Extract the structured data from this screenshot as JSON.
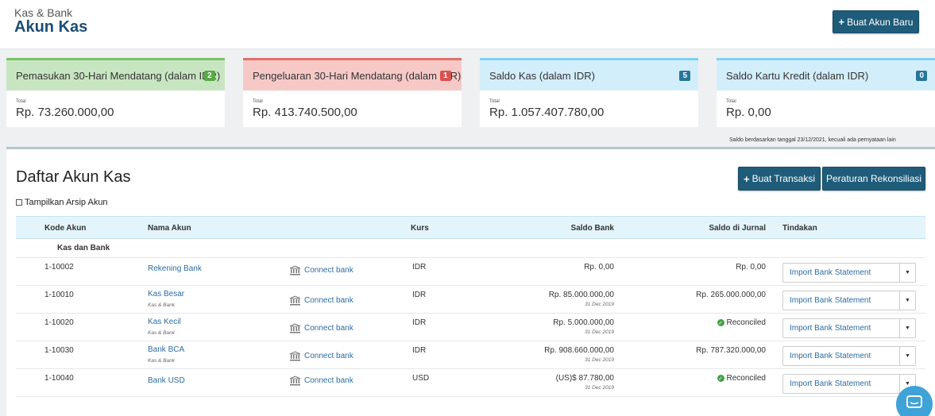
{
  "header": {
    "breadcrumb": "Kas & Bank",
    "title": "Akun Kas",
    "new_account_button": "Buat Akun Baru"
  },
  "cards": [
    {
      "title": "Pemasukan 30-Hari Mendatang (dalam IDR)",
      "badge": "2",
      "total_label": "Total",
      "value": "Rp. 73.260.000,00"
    },
    {
      "title": "Pengeluaran 30-Hari Mendatang (dalam IDR)",
      "badge": "1",
      "total_label": "Total",
      "value": "Rp. 413.740.500,00"
    },
    {
      "title": "Saldo Kas (dalam IDR)",
      "badge": "5",
      "total_label": "Total",
      "value": "Rp. 1.057.407.780,00"
    },
    {
      "title": "Saldo Kartu Kredit (dalam IDR)",
      "badge": "0",
      "total_label": "Total",
      "value": "Rp. 0,00"
    }
  ],
  "balance_note": "Saldo berdasarkan tanggal 23/12/2021, kecuali ada pernyataan lain",
  "list": {
    "title": "Daftar Akun Kas",
    "archive_label": "Tampilkan Arsip Akun",
    "transaction_button": "Buat Transaksi",
    "rules_button": "Peraturan Rekonsiliasi",
    "columns": {
      "code": "Kode Akun",
      "name": "Nama Akun",
      "currency": "Kurs",
      "bank_balance": "Saldo Bank",
      "journal_balance": "Saldo di Jurnal",
      "actions": "Tindakan"
    },
    "group": "Kas dan Bank",
    "rows": [
      {
        "code": "1-10002",
        "name": "Rekening Bank",
        "sub": "",
        "connect": "Connect bank",
        "currency": "IDR",
        "bank": "Rp. 0,00",
        "bank_date": "",
        "journal": "Rp. 0,00",
        "action": "Import Bank Statement"
      },
      {
        "code": "1-10010",
        "name": "Kas Besar",
        "sub": "Kas & Bank",
        "connect": "Connect bank",
        "currency": "IDR",
        "bank": "Rp. 85.000.000,00",
        "bank_date": "31 Dec 2019",
        "journal": "Rp. 265.000.000,00",
        "action": "Import Bank Statement"
      },
      {
        "code": "1-10020",
        "name": "Kas Kecil",
        "sub": "Kas & Bank",
        "connect": "Connect bank",
        "currency": "IDR",
        "bank": "Rp. 5.000.000,00",
        "bank_date": "31 Dec 2019",
        "journal": "Reconciled",
        "action": "Import Bank Statement"
      },
      {
        "code": "1-10030",
        "name": "Bank BCA",
        "sub": "Kas & Bank",
        "connect": "Connect bank",
        "currency": "IDR",
        "bank": "Rp. 908.660.000,00",
        "bank_date": "31 Dec 2019",
        "journal": "Rp. 787.320.000,00",
        "action": "Import Bank Statement"
      },
      {
        "code": "1-10040",
        "name": "Bank USD",
        "sub": "",
        "connect": "Connect bank",
        "currency": "USD",
        "bank": "(US)$ 87.780,00",
        "bank_date": "31 Dec 2019",
        "journal": "Reconciled",
        "action": "Import Bank Statement"
      }
    ]
  },
  "icons": {
    "plus": "plus-icon",
    "bank": "bank-icon",
    "check": "check-circle-icon",
    "caret": "caret-down-icon",
    "chat": "chat-icon"
  }
}
